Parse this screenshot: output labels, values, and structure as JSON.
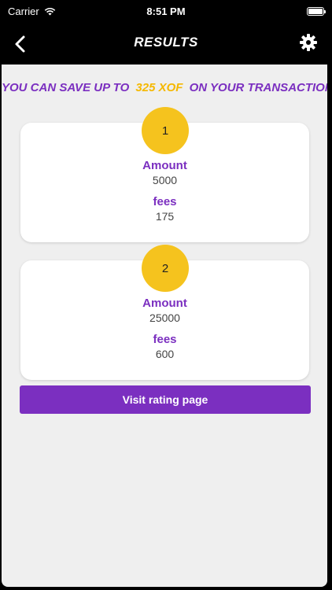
{
  "status_bar": {
    "carrier": "Carrier",
    "time": "8:51 PM",
    "icons": [
      "wifi-icon",
      "battery-icon"
    ]
  },
  "nav": {
    "title": "RESULTS",
    "back_icon": "chevron-left-icon",
    "settings_icon": "gear-icon"
  },
  "banner": {
    "prefix": "YOU CAN SAVE UP TO",
    "amount": "325 XOF",
    "suffix": "ON YOUR TRANSACTION"
  },
  "results": [
    {
      "number": "1",
      "amount_label": "Amount",
      "amount_value": "5000",
      "fees_label": "fees",
      "fees_value": "175"
    },
    {
      "number": "2",
      "amount_label": "Amount",
      "amount_value": "25000",
      "fees_label": "fees",
      "fees_value": "600"
    }
  ],
  "visit_button_label": "Visit rating page",
  "colors": {
    "accent": "#7b2fc0",
    "highlight": "#f5b800",
    "badge": "#f5c31e",
    "background": "#efefef"
  }
}
